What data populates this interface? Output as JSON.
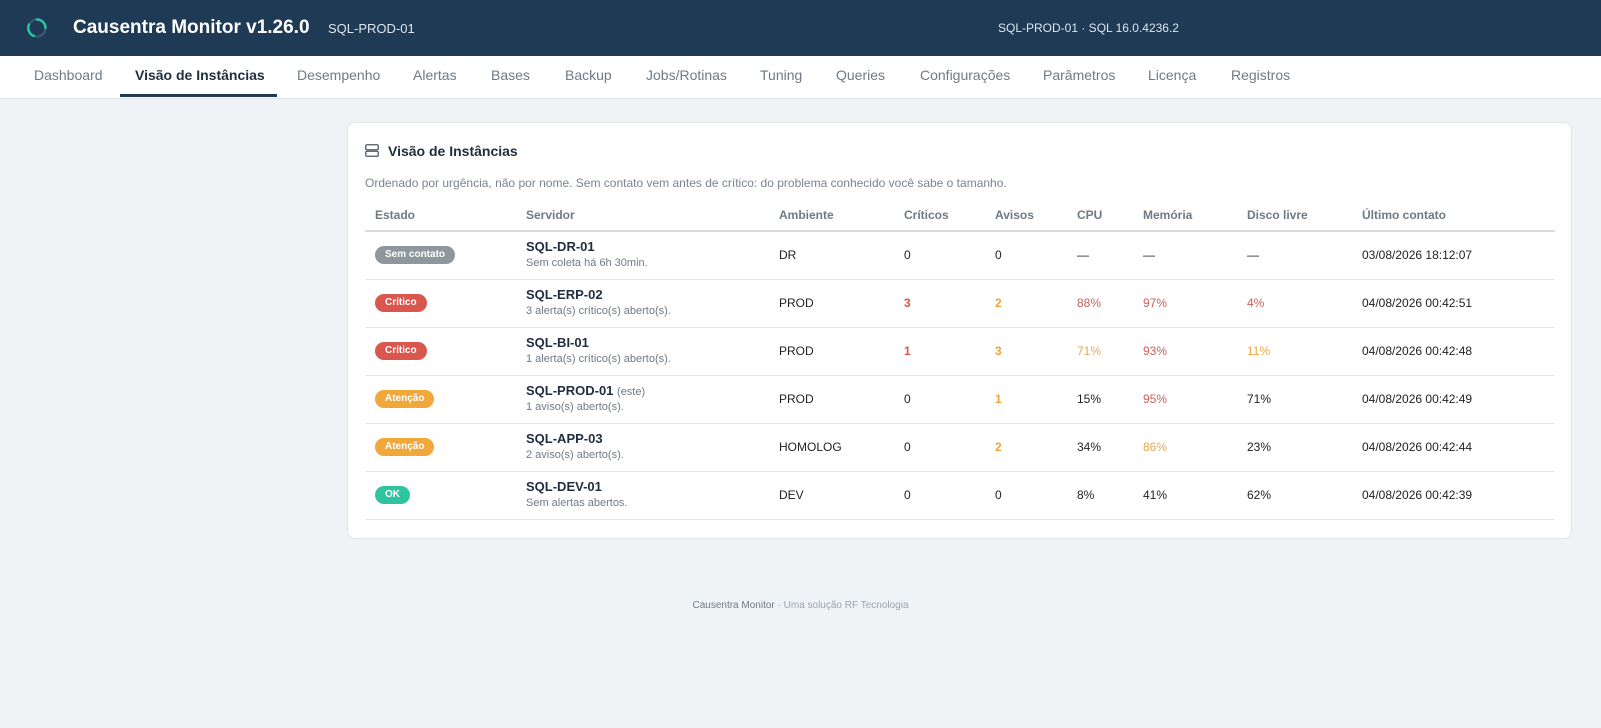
{
  "header": {
    "app_title": "Causentra Monitor v1.26.0",
    "instance": "SQL-PROD-01",
    "server_info": "SQL-PROD-01 · SQL 16.0.4236.2",
    "logo_icon": "loading-ring-icon",
    "accent": "#1e3a55"
  },
  "tabs": [
    {
      "label": "Dashboard"
    },
    {
      "label": "Visão de Instâncias",
      "active": true
    },
    {
      "label": "Desempenho"
    },
    {
      "label": "Alertas"
    },
    {
      "label": "Bases"
    },
    {
      "label": "Backup"
    },
    {
      "label": "Jobs/Rotinas"
    },
    {
      "label": "Tuning"
    },
    {
      "label": "Queries"
    },
    {
      "label": "Configurações"
    },
    {
      "label": "Parâmetros"
    },
    {
      "label": "Licença"
    },
    {
      "label": "Registros"
    }
  ],
  "card": {
    "icon": "server-stack-icon",
    "title": "Visão de Instâncias",
    "subtitle": "Ordenado por urgência, não por nome. Sem contato vem antes de crítico: do problema conhecido você sabe o tamanho."
  },
  "table": {
    "columns": [
      "Estado",
      "Servidor",
      "Ambiente",
      "Críticos",
      "Avisos",
      "CPU",
      "Memória",
      "Disco livre",
      "Último contato"
    ],
    "rows": [
      {
        "status": "Sem contato",
        "status_color": "#8d979e",
        "server": "SQL-DR-01",
        "note": "",
        "desc": "Sem coleta há 6h 30min.",
        "env": "DR",
        "critical": "0",
        "critical_color": "#222222",
        "warnings": "0",
        "warnings_color": "#222222",
        "cpu": "—",
        "cpu_color": "#222222",
        "mem": "—",
        "mem_color": "#222222",
        "disk": "—",
        "disk_color": "#222222",
        "last": "03/08/2026 18:12:07"
      },
      {
        "status": "Crítico",
        "status_color": "#d9574d",
        "server": "SQL-ERP-02",
        "note": "",
        "desc": "3 alerta(s) crítico(s) aberto(s).",
        "env": "PROD",
        "critical": "3",
        "critical_color": "#d9574d",
        "warnings": "2",
        "warnings_color": "#eea13c",
        "cpu": "88%",
        "cpu_color": "#c9605a",
        "mem": "97%",
        "mem_color": "#c9605a",
        "disk": "4%",
        "disk_color": "#c9605a",
        "last": "04/08/2026 00:42:51"
      },
      {
        "status": "Crítico",
        "status_color": "#d9574d",
        "server": "SQL-BI-01",
        "note": "",
        "desc": "1 alerta(s) crítico(s) aberto(s).",
        "env": "PROD",
        "critical": "1",
        "critical_color": "#d9574d",
        "warnings": "3",
        "warnings_color": "#eea13c",
        "cpu": "71%",
        "cpu_color": "#e8a94c",
        "mem": "93%",
        "mem_color": "#c9605a",
        "disk": "11%",
        "disk_color": "#e8a94c",
        "last": "04/08/2026 00:42:48"
      },
      {
        "status": "Atenção",
        "status_color": "#f0a83a",
        "server": "SQL-PROD-01",
        "note": "(este)",
        "desc": "1 aviso(s) aberto(s).",
        "env": "PROD",
        "critical": "0",
        "critical_color": "#222222",
        "warnings": "1",
        "warnings_color": "#eea13c",
        "cpu": "15%",
        "cpu_color": "#222222",
        "mem": "95%",
        "mem_color": "#c9605a",
        "disk": "71%",
        "disk_color": "#222222",
        "last": "04/08/2026 00:42:49"
      },
      {
        "status": "Atenção",
        "status_color": "#f0a83a",
        "server": "SQL-APP-03",
        "note": "",
        "desc": "2 aviso(s) aberto(s).",
        "env": "HOMOLOG",
        "critical": "0",
        "critical_color": "#222222",
        "warnings": "2",
        "warnings_color": "#eea13c",
        "cpu": "34%",
        "cpu_color": "#222222",
        "mem": "86%",
        "mem_color": "#e8a94c",
        "disk": "23%",
        "disk_color": "#222222",
        "last": "04/08/2026 00:42:44"
      },
      {
        "status": "OK",
        "status_color": "#2ec4a0",
        "server": "SQL-DEV-01",
        "note": "",
        "desc": "Sem alertas abertos.",
        "env": "DEV",
        "critical": "0",
        "critical_color": "#222222",
        "warnings": "0",
        "warnings_color": "#222222",
        "cpu": "8%",
        "cpu_color": "#222222",
        "mem": "41%",
        "mem_color": "#222222",
        "disk": "62%",
        "disk_color": "#222222",
        "last": "04/08/2026 00:42:39"
      }
    ]
  },
  "footer": {
    "brand": "Causentra Monitor",
    "tagline": " · Uma solução RF Tecnologia"
  }
}
